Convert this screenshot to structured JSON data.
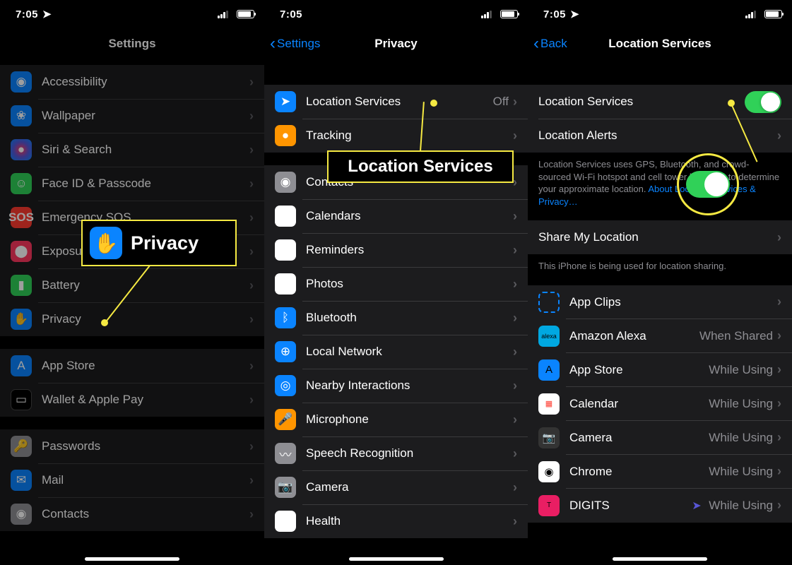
{
  "status": {
    "time": "7:05"
  },
  "screen1": {
    "title": "Settings",
    "g1": [
      {
        "icon": "accessibility",
        "label": "Accessibility"
      },
      {
        "icon": "wallpaper",
        "label": "Wallpaper"
      },
      {
        "icon": "siri",
        "label": "Siri & Search"
      },
      {
        "icon": "faceid",
        "label": "Face ID & Passcode"
      },
      {
        "icon": "sos",
        "label": "Emergency SOS"
      },
      {
        "icon": "exposure",
        "label": "Exposure Notifications"
      },
      {
        "icon": "battery",
        "label": "Battery"
      },
      {
        "icon": "privacy",
        "label": "Privacy"
      }
    ],
    "g2": [
      {
        "icon": "appstore",
        "label": "App Store"
      },
      {
        "icon": "wallet",
        "label": "Wallet & Apple Pay"
      }
    ],
    "g3": [
      {
        "icon": "passwords",
        "label": "Passwords"
      },
      {
        "icon": "mail",
        "label": "Mail"
      },
      {
        "icon": "contacts",
        "label": "Contacts"
      }
    ]
  },
  "screen2": {
    "back": "Settings",
    "title": "Privacy",
    "g1": [
      {
        "icon": "location",
        "label": "Location Services",
        "detail": "Off"
      },
      {
        "icon": "tracking",
        "label": "Tracking"
      }
    ],
    "g2": [
      {
        "icon": "contacts2",
        "label": "Contacts"
      },
      {
        "icon": "calendars",
        "label": "Calendars"
      },
      {
        "icon": "reminders",
        "label": "Reminders"
      },
      {
        "icon": "photos",
        "label": "Photos"
      },
      {
        "icon": "bluetooth",
        "label": "Bluetooth"
      },
      {
        "icon": "network",
        "label": "Local Network"
      },
      {
        "icon": "nearby",
        "label": "Nearby Interactions"
      },
      {
        "icon": "microphone",
        "label": "Microphone"
      },
      {
        "icon": "speech",
        "label": "Speech Recognition"
      },
      {
        "icon": "camera",
        "label": "Camera"
      },
      {
        "icon": "health",
        "label": "Health"
      }
    ]
  },
  "screen3": {
    "back": "Back",
    "title": "Location Services",
    "locserv": "Location Services",
    "localerts": "Location Alerts",
    "footer1a": "Location Services uses GPS, Bluetooth, and crowd-sourced Wi-Fi hotspot and cell tower locations to determine your approximate location. ",
    "footer1link": "About Location Services & Privacy…",
    "share": "Share My Location",
    "footer2": "This iPhone is being used for location sharing.",
    "apps": [
      {
        "icon": "appclips",
        "label": "App Clips",
        "detail": ""
      },
      {
        "icon": "alexa",
        "label": "Amazon Alexa",
        "detail": "When Shared"
      },
      {
        "icon": "appstore2",
        "label": "App Store",
        "detail": "While Using"
      },
      {
        "icon": "calendar2",
        "label": "Calendar",
        "detail": "While Using"
      },
      {
        "icon": "camera2",
        "label": "Camera",
        "detail": "While Using"
      },
      {
        "icon": "chrome",
        "label": "Chrome",
        "detail": "While Using"
      },
      {
        "icon": "digits",
        "label": "DIGITS",
        "detail": "While Using",
        "svc": true
      }
    ]
  },
  "callouts": {
    "privacy": "Privacy",
    "locserv": "Location Services"
  }
}
